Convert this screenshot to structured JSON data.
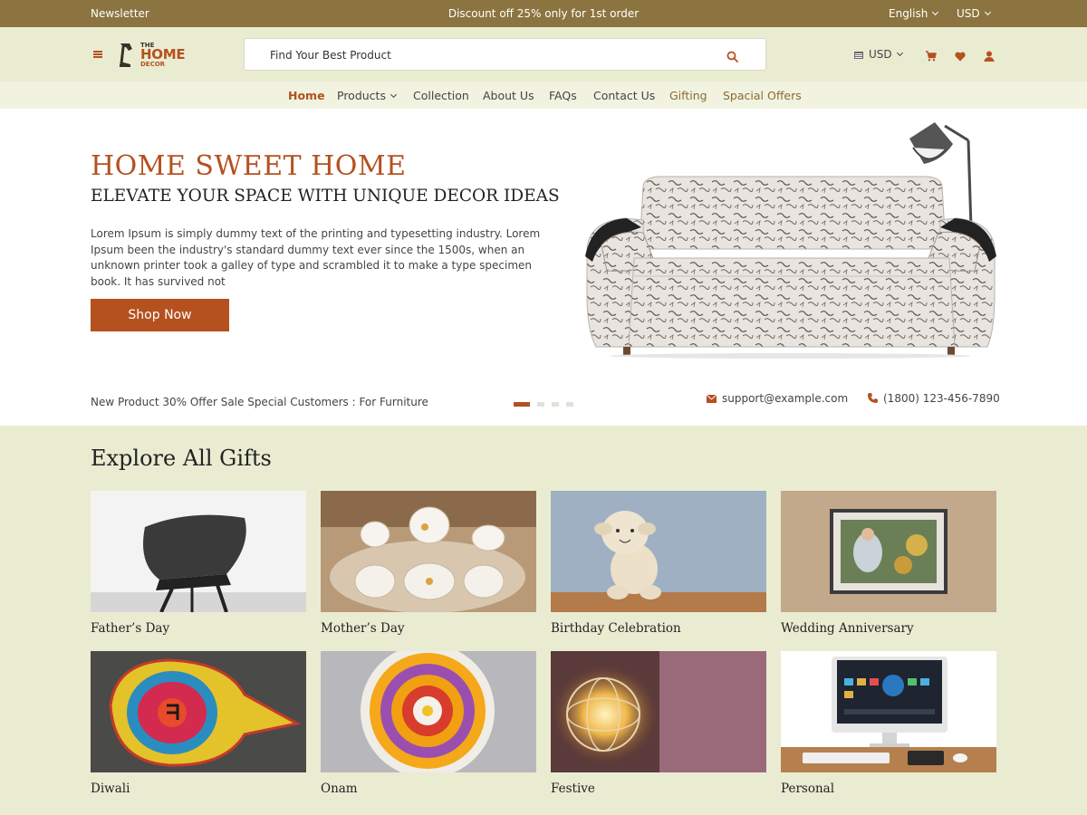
{
  "topbar": {
    "newsletter": "Newsletter",
    "promo": "Discount off 25% only for 1st order",
    "language": "English",
    "currency": "USD"
  },
  "header": {
    "logo": {
      "the": "THE",
      "home": "HOME",
      "decor": "DECOR"
    },
    "search_placeholder": "Find Your Best Product",
    "currency": "USD",
    "icons": [
      "menu-icon",
      "search-icon",
      "flag-icon",
      "cart-icon",
      "heart-icon",
      "user-icon"
    ]
  },
  "nav": {
    "items": [
      "Home",
      "Products",
      "Collection",
      "About Us",
      "FAQs",
      "Contact Us",
      "Gifting",
      "Spacial Offers"
    ]
  },
  "hero": {
    "title": "HOME SWEET HOME",
    "subtitle": "ELEVATE YOUR SPACE WITH UNIQUE DECOR IDEAS",
    "description": "Lorem Ipsum is simply dummy text of the printing and typesetting industry. Lorem Ipsum been the industry's standard dummy text ever since the 1500s, when an unknown printer took a galley of type and scrambled it to make a type specimen book. It has survived not",
    "cta": "Shop Now",
    "offer": "New Product 30% Offer Sale Special Customers : For Furniture",
    "email": "support@example.com",
    "phone": "(1800) 123-456-7890",
    "slides": 4,
    "active_slide": 1
  },
  "gifts": {
    "title": "Explore All Gifts",
    "items": [
      {
        "label": "Father’s Day"
      },
      {
        "label": "Mother’s Day"
      },
      {
        "label": "Birthday Celebration"
      },
      {
        "label": "Wedding Anniversary"
      },
      {
        "label": "Diwali"
      },
      {
        "label": "Onam"
      },
      {
        "label": "Festive"
      },
      {
        "label": "Personal"
      }
    ]
  },
  "colors": {
    "accent": "#b4511f",
    "topbar": "#8c7440",
    "background": "#eaecd2",
    "nav_background": "#f1f3e0"
  }
}
